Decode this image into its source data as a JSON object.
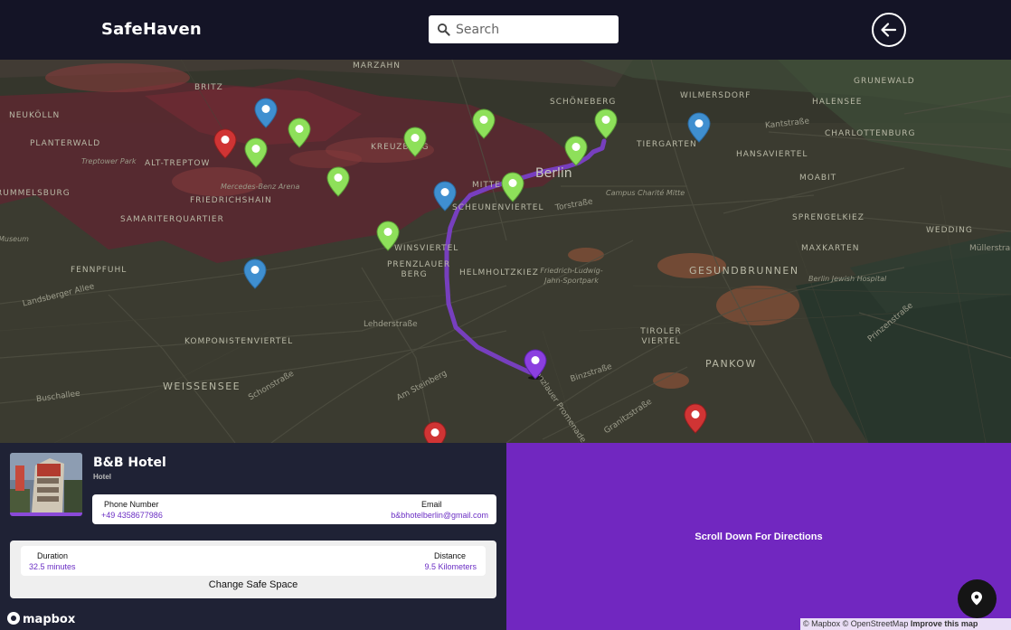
{
  "header": {
    "brand": "SafeHaven",
    "search_placeholder": "Search"
  },
  "map": {
    "city": "Berlin",
    "districts": [
      "MARZAHN",
      "BRITZ",
      "RUMMELSBURG",
      "PLANTERWALD",
      "ALT-TREPTOW",
      "KREUZBERG",
      "FRIEDRICHSHAIN",
      "SAMARITERQUARTIER",
      "FENNPFUHL",
      "KOMPONISTENVIERTEL",
      "WEISSENSEE",
      "WINSVIERTEL",
      "PRENZLAUER BERG",
      "HELMHOLTZKIEZ",
      "MITTE",
      "SCHEUNENVIERTEL",
      "SCHÖNEBERG",
      "TIERGARTEN",
      "HANSAVIERTEL",
      "MOABIT",
      "SPRENGELKIEZ",
      "MAXKARTEN",
      "WEDDING",
      "GESUNDBRUNNEN",
      "TIROLER VIERTEL",
      "PANKOW",
      "WILMERSDORF",
      "HALENSEE",
      "CHARLOTTENBURG",
      "GRUNEWALD",
      "NEUKÖLLN"
    ],
    "streets": [
      "Landsberger Allee",
      "Buschallee",
      "Lehderstraße",
      "Schonstraße",
      "Am Steinberg",
      "Prenzlauer Promenade",
      "Binzstraße",
      "Granitzstraße",
      "Torstraße",
      "Kantstraße",
      "Prinzenstraße",
      "Müllerstraße"
    ],
    "pois": [
      "Treptower Park",
      "Mercedes-Benz Arena",
      "Campus Charité Mitte",
      "Friedrich-Ludwig-Jahn-Sportpark",
      "Berlin Jewish Hospital",
      "Museum"
    ]
  },
  "hotel": {
    "name": "B&B Hotel",
    "type": "Hotel",
    "phone_label": "Phone Number",
    "phone": "+49 4358677986",
    "email_label": "Email",
    "email": "b&bhotelberlin@gmail.com"
  },
  "trip": {
    "duration_label": "Duration",
    "duration": "32.5 minutes",
    "distance_label": "Distance",
    "distance": "9.5 Kilometers",
    "change_label": "Change Safe Space"
  },
  "directions": {
    "title": "Scroll Down For Directions"
  },
  "attribution": {
    "logo": "mapbox",
    "text": "© Mapbox © OpenStreetMap",
    "improve": "Improve this map"
  },
  "colors": {
    "header_bg": "#141426",
    "panel_bg": "#1f2235",
    "accent": "#7127c0",
    "pin_green": "#8ee05a",
    "pin_blue": "#3f8fd0",
    "pin_red": "#d03434",
    "pin_purple": "#8b3fe0"
  }
}
